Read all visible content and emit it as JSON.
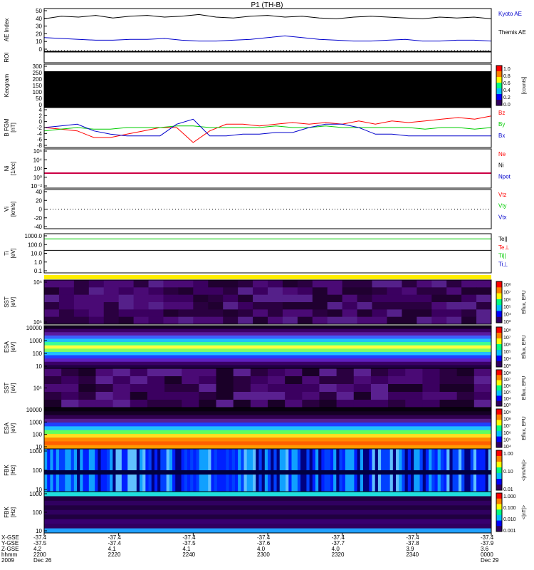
{
  "title": "P1 (TH-B)",
  "colors": {
    "black": "#000000",
    "blue": "#0000cc",
    "red": "#ff0000",
    "green": "#00cc00",
    "purple": "#6600cc"
  },
  "panels": [
    {
      "id": "ae",
      "ylabel": [
        "AE Index"
      ],
      "yticks": [
        "50",
        "40",
        "30",
        "20",
        "10",
        "0"
      ],
      "legend": [
        {
          "text": "Kyoto AE",
          "color": "#0000cc"
        },
        {
          "text": "Themis AE",
          "color": "#000000"
        }
      ]
    },
    {
      "id": "roi",
      "ylabel": [
        "ROI"
      ]
    },
    {
      "id": "keogram",
      "ylabel": [
        "Keogram"
      ],
      "yticks": [
        "300",
        "250",
        "200",
        "150",
        "100",
        "50",
        "0"
      ],
      "colorbar": {
        "ticks": [
          "1.0",
          "0.8",
          "0.6",
          "0.4",
          "0.2",
          "0.0"
        ],
        "label": "[counts]"
      }
    },
    {
      "id": "bfgm",
      "ylabel": [
        "B FGM",
        "[nT]"
      ],
      "yticks": [
        "4",
        "2",
        "0",
        "-2",
        "-4",
        "-6",
        "-8"
      ],
      "legend": [
        {
          "text": "Bz",
          "color": "#ff0000"
        },
        {
          "text": "By",
          "color": "#00cc00"
        },
        {
          "text": "Bx",
          "color": "#0000cc"
        }
      ]
    },
    {
      "id": "ni",
      "ylabel": [
        "Ni",
        "[1/cc]"
      ],
      "yticks": [
        "10⁶",
        "10⁴",
        "10²",
        "10⁰",
        "10⁻²"
      ],
      "legend": [
        {
          "text": "Ne",
          "color": "#ff0000"
        },
        {
          "text": "Ni",
          "color": "#000000"
        },
        {
          "text": "Npot",
          "color": "#0000cc"
        }
      ]
    },
    {
      "id": "vi",
      "ylabel": [
        "Vi",
        "[km/s]"
      ],
      "yticks": [
        "40",
        "20",
        "0",
        "-20",
        "-40"
      ],
      "legend": [
        {
          "text": "Vtz",
          "color": "#ff0000"
        },
        {
          "text": "Vty",
          "color": "#00cc00"
        },
        {
          "text": "Vtx",
          "color": "#0000cc"
        }
      ]
    },
    {
      "id": "ti",
      "ylabel": [
        "Ti",
        "[eV]"
      ],
      "yticks": [
        "1000.0",
        "100.0",
        "10.0",
        "1.0",
        "0.1"
      ],
      "legend": [
        {
          "text": "Te||",
          "color": "#000000"
        },
        {
          "text": "Te⊥",
          "color": "#ff0000"
        },
        {
          "text": "Ti||",
          "color": "#00cc00"
        },
        {
          "text": "Ti⊥",
          "color": "#0000cc"
        }
      ]
    },
    {
      "id": "sst_i",
      "ylabel": [
        "SST",
        "[eV]"
      ],
      "yticks": [
        "10⁶",
        "10⁵"
      ],
      "colorbar": {
        "ticks": [
          "10⁸",
          "10⁷",
          "10⁶",
          "10⁵",
          "10⁴",
          "10³"
        ],
        "label": "Eflux, EFU"
      }
    },
    {
      "id": "esa_i",
      "ylabel": [
        "ESA",
        "[eV]"
      ],
      "yticks": [
        "10000",
        "1000",
        "100",
        "10"
      ],
      "colorbar": {
        "ticks": [
          "10⁸",
          "10⁷",
          "10⁶",
          "10⁵",
          "10⁴",
          "10³"
        ],
        "label": "Eflux, EFU"
      }
    },
    {
      "id": "sst_e",
      "ylabel": [
        "SST",
        "[eV]"
      ],
      "yticks": [
        "10⁵"
      ],
      "colorbar": {
        "ticks": [
          "10⁸",
          "10⁷",
          "10⁶",
          "10⁵",
          "10⁴",
          "10³"
        ],
        "label": "Eflux, EFU"
      }
    },
    {
      "id": "esa_e",
      "ylabel": [
        "ESA",
        "[eV]"
      ],
      "yticks": [
        "10000",
        "1000",
        "100",
        "10"
      ],
      "colorbar": {
        "ticks": [
          "10⁹",
          "10⁸",
          "10⁷",
          "10⁶",
          "10⁵",
          "10⁴"
        ],
        "label": "Eflux, EFU"
      }
    },
    {
      "id": "fbk_e",
      "ylabel": [
        "FBK",
        "[Hz]"
      ],
      "yticks": [
        "1000",
        "100",
        "10"
      ],
      "colorbar": {
        "ticks": [
          "1.00",
          "0.10",
          "0.01"
        ],
        "label": "<|mV/m|>"
      }
    },
    {
      "id": "fbk_b",
      "ylabel": [
        "FBK",
        "[Hz]"
      ],
      "yticks": [
        "1000",
        "100",
        "10"
      ],
      "colorbar": {
        "ticks": [
          "1.000",
          "0.100",
          "0.010",
          "0.001"
        ],
        "label": "<|nT|>"
      }
    }
  ],
  "footer": {
    "row_labels": [
      "X-GSE",
      "Y-GSE",
      "Z-GSE",
      "hhmm",
      "2009"
    ],
    "columns": [
      [
        "-37.4",
        "-37.5",
        "4.2",
        "2200",
        "Dec 26"
      ],
      [
        "-37.4",
        "-37.4",
        "4.1",
        "2220",
        ""
      ],
      [
        "-37.4",
        "-37.5",
        "4.1",
        "2240",
        ""
      ],
      [
        "-37.4",
        "-37.6",
        "4.0",
        "2300",
        ""
      ],
      [
        "-37.4",
        "-37.7",
        "4.0",
        "2320",
        ""
      ],
      [
        "-37.4",
        "-37.8",
        "3.9",
        "2340",
        ""
      ],
      [
        "-37.4",
        "-37.9",
        "3.6",
        "0000",
        "Dec 29"
      ]
    ]
  },
  "chart_data": {
    "type": "line",
    "title": "P1 (TH-B)",
    "x_ticks": [
      "2200",
      "2220",
      "2240",
      "2300",
      "2320",
      "2340",
      "0000"
    ],
    "series": [
      {
        "name": "Themis AE",
        "panel": "ae",
        "values": [
          38,
          41,
          40,
          42,
          39,
          41,
          42,
          40,
          41,
          43,
          40,
          39,
          41,
          42,
          40,
          41,
          39,
          38,
          40,
          41,
          40,
          39,
          38,
          40,
          39,
          40,
          38
        ]
      },
      {
        "name": "Kyoto AE",
        "panel": "ae",
        "values": [
          16,
          15,
          14,
          13,
          13,
          14,
          14,
          15,
          13,
          12,
          12,
          13,
          14,
          16,
          18,
          16,
          14,
          13,
          12,
          12,
          13,
          14,
          12,
          12,
          13,
          13,
          12
        ]
      },
      {
        "name": "Bz",
        "panel": "bfgm",
        "values": [
          -2,
          -2.5,
          -3,
          -5,
          -5,
          -4,
          -3,
          -2,
          -2,
          -6.5,
          -3,
          -1,
          -1,
          -1.5,
          -1,
          -0.5,
          -1,
          -0.5,
          -1,
          0,
          -1,
          0,
          -0.5,
          0,
          0.5,
          1,
          0.5,
          1.5
        ]
      },
      {
        "name": "By",
        "panel": "bfgm",
        "values": [
          -3,
          -2.5,
          -2,
          -2.5,
          -2.5,
          -2,
          -2,
          -2,
          -1.5,
          -1.5,
          -2,
          -2,
          -2,
          -2,
          -1.5,
          -2,
          -2,
          -1.5,
          -2,
          -2,
          -2,
          -2,
          -2,
          -2.5,
          -2,
          -2,
          -2.5,
          -2
        ]
      },
      {
        "name": "Bx",
        "panel": "bfgm",
        "values": [
          -2,
          -1.5,
          -1,
          -3,
          -4,
          -4.5,
          -4.5,
          -4.5,
          -1,
          0.5,
          -4.5,
          -4.5,
          -4,
          -4,
          -3.5,
          -3.5,
          -2,
          -1,
          -1,
          -2,
          -4,
          -4,
          -4.5,
          -4.5,
          -4.5,
          -4.5,
          -4.5,
          -4.5
        ]
      },
      {
        "name": "Ti||",
        "panel": "ti",
        "values": [
          300,
          300,
          300,
          300,
          300,
          300,
          300,
          300,
          300,
          300,
          300,
          300,
          300,
          300,
          300,
          300,
          300,
          300,
          300,
          300
        ]
      },
      {
        "name": "Te||",
        "panel": "ti",
        "values": [
          20,
          20,
          20,
          20,
          20,
          20,
          20,
          20,
          20,
          20,
          20,
          20,
          20,
          20,
          20,
          20,
          20,
          20,
          20,
          20
        ]
      }
    ],
    "ylim_ae": [
      0,
      50
    ],
    "ylim_bfgm": [
      -8,
      4
    ]
  }
}
